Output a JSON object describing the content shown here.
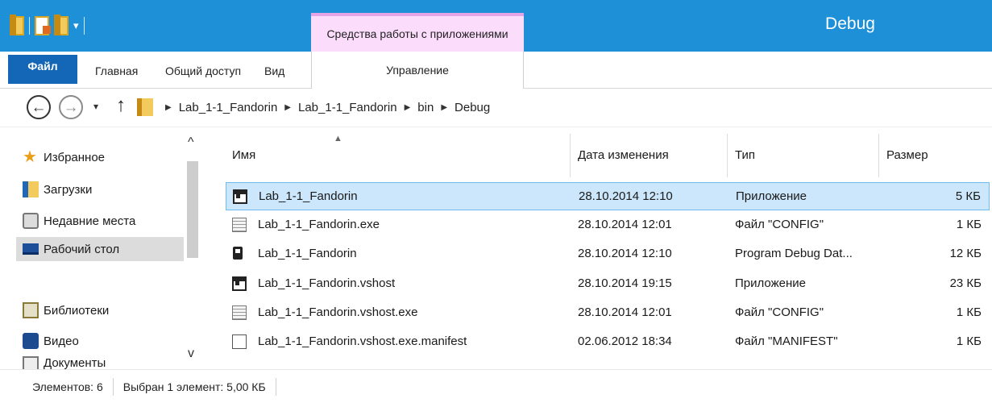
{
  "window": {
    "title": "Debug",
    "contextual_tool": "Средства работы с приложениями"
  },
  "ribbon": {
    "tabs": [
      "Файл",
      "Главная",
      "Общий доступ",
      "Вид",
      "Управление"
    ]
  },
  "address": {
    "path": [
      "Lab_1-1_Fandorin",
      "Lab_1-1_Fandorin",
      "bin",
      "Debug"
    ]
  },
  "sidebar": {
    "favorites": "Избранное",
    "downloads": "Загрузки",
    "recent_places": "Недавние места",
    "desktop": "Рабочий стол",
    "libraries": "Библиотеки",
    "video": "Видео",
    "documents": "Документы"
  },
  "columns": {
    "name": "Имя",
    "date": "Дата изменения",
    "type": "Тип",
    "size": "Размер"
  },
  "files": [
    {
      "icon": "application-icon",
      "name": "Lab_1-1_Fandorin",
      "date": "28.10.2014 12:10",
      "type": "Приложение",
      "size": "5 КБ",
      "selected": true
    },
    {
      "icon": "config-file-icon",
      "name": "Lab_1-1_Fandorin.exe",
      "date": "28.10.2014 12:01",
      "type": "Файл \"CONFIG\"",
      "size": "1 КБ"
    },
    {
      "icon": "debug-database-icon",
      "name": "Lab_1-1_Fandorin",
      "date": "28.10.2014 12:10",
      "type": "Program Debug Dat...",
      "size": "12 КБ"
    },
    {
      "icon": "application-icon",
      "name": "Lab_1-1_Fandorin.vshost",
      "date": "28.10.2014 19:15",
      "type": "Приложение",
      "size": "23 КБ"
    },
    {
      "icon": "config-file-icon",
      "name": "Lab_1-1_Fandorin.vshost.exe",
      "date": "28.10.2014 12:01",
      "type": "Файл \"CONFIG\"",
      "size": "1 КБ"
    },
    {
      "icon": "blank-file-icon",
      "name": "Lab_1-1_Fandorin.vshost.exe.manifest",
      "date": "02.06.2012 18:34",
      "type": "Файл \"MANIFEST\"",
      "size": "1 КБ"
    }
  ],
  "status": {
    "items_count": "Элементов: 6",
    "selection": "Выбран 1 элемент: 5,00 КБ"
  },
  "colors": {
    "titlebar": "#1e90d8",
    "file_tab": "#1466b6",
    "contextual_tab": "#fbdcfb",
    "selection": "#cce7fb"
  }
}
